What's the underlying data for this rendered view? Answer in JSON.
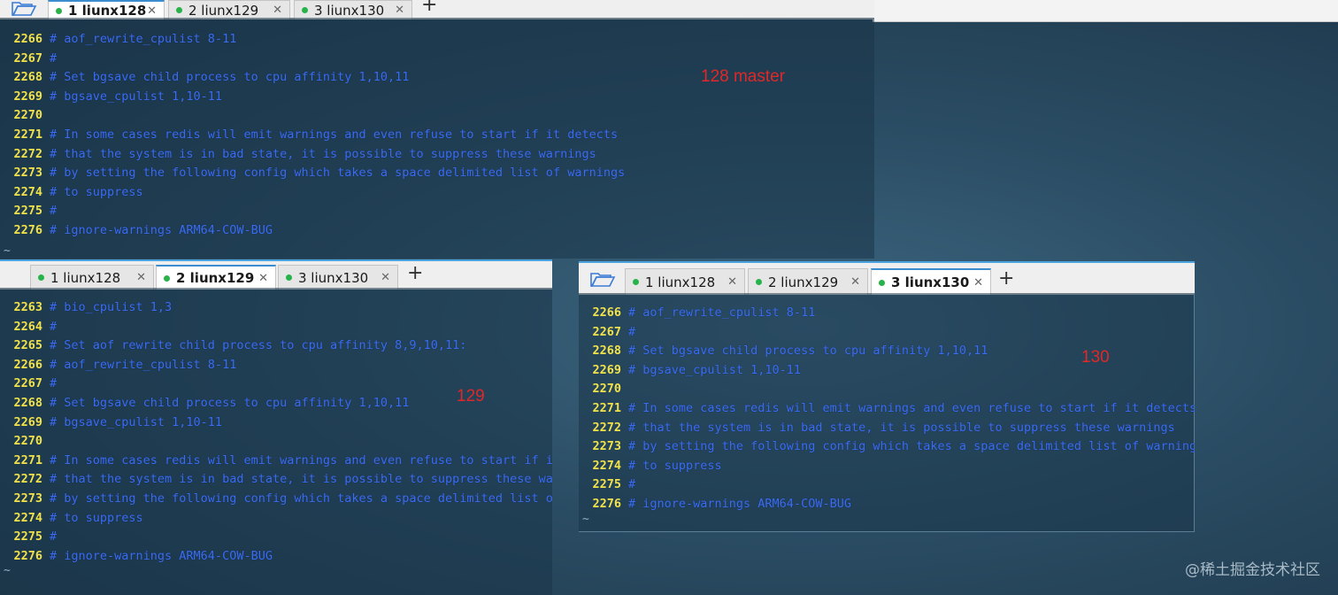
{
  "tab_labels": [
    "1 liunx128",
    "2 liunx129",
    "3 liunx130"
  ],
  "new_tab_label": "+",
  "close_glyph": "✕",
  "tilde": "~",
  "window_128": {
    "active_tab": 0,
    "note": "128 master",
    "lines": [
      {
        "n": "2266",
        "t": "# aof_rewrite_cpulist 8-11"
      },
      {
        "n": "2267",
        "t": "#"
      },
      {
        "n": "2268",
        "t": "# Set bgsave child process to cpu affinity 1,10,11"
      },
      {
        "n": "2269",
        "t": "# bgsave_cpulist 1,10-11"
      },
      {
        "n": "2270",
        "t": ""
      },
      {
        "n": "2271",
        "t": "# In some cases redis will emit warnings and even refuse to start if it detects"
      },
      {
        "n": "2272",
        "t": "# that the system is in bad state, it is possible to suppress these warnings"
      },
      {
        "n": "2273",
        "t": "# by setting the following config which takes a space delimited list of warnings"
      },
      {
        "n": "2274",
        "t": "# to suppress"
      },
      {
        "n": "2275",
        "t": "#"
      },
      {
        "n": "2276",
        "t": "# ignore-warnings ARM64-COW-BUG"
      }
    ]
  },
  "window_129": {
    "active_tab": 1,
    "note": "129",
    "lines": [
      {
        "n": "2263",
        "t": "# bio_cpulist 1,3"
      },
      {
        "n": "2264",
        "t": "#"
      },
      {
        "n": "2265",
        "t": "# Set aof rewrite child process to cpu affinity 8,9,10,11:"
      },
      {
        "n": "2266",
        "t": "# aof_rewrite_cpulist 8-11"
      },
      {
        "n": "2267",
        "t": "#"
      },
      {
        "n": "2268",
        "t": "# Set bgsave child process to cpu affinity 1,10,11"
      },
      {
        "n": "2269",
        "t": "# bgsave_cpulist 1,10-11"
      },
      {
        "n": "2270",
        "t": ""
      },
      {
        "n": "2271",
        "t": "# In some cases redis will emit warnings and even refuse to start if it d"
      },
      {
        "n": "2272",
        "t": "# that the system is in bad state, it is possible to suppress these warni"
      },
      {
        "n": "2273",
        "t": "# by setting the following config which takes a space delimited list of w"
      },
      {
        "n": "2274",
        "t": "# to suppress"
      },
      {
        "n": "2275",
        "t": "#"
      },
      {
        "n": "2276",
        "t": "# ignore-warnings ARM64-COW-BUG"
      }
    ]
  },
  "window_130": {
    "active_tab": 2,
    "note": "130",
    "lines": [
      {
        "n": "2266",
        "t": "# aof_rewrite_cpulist 8-11"
      },
      {
        "n": "2267",
        "t": "#"
      },
      {
        "n": "2268",
        "t": "# Set bgsave child process to cpu affinity 1,10,11"
      },
      {
        "n": "2269",
        "t": "# bgsave_cpulist 1,10-11"
      },
      {
        "n": "2270",
        "t": ""
      },
      {
        "n": "2271",
        "t": "# In some cases redis will emit warnings and even refuse to start if it detects"
      },
      {
        "n": "2272",
        "t": "# that the system is in bad state, it is possible to suppress these warnings"
      },
      {
        "n": "2273",
        "t": "# by setting the following config which takes a space delimited list of warnings"
      },
      {
        "n": "2274",
        "t": "# to suppress"
      },
      {
        "n": "2275",
        "t": "#"
      },
      {
        "n": "2276",
        "t": "# ignore-warnings ARM64-COW-BUG"
      }
    ]
  },
  "watermark": "@稀土掘金技术社区",
  "colors": {
    "line_number": "#f2e24a",
    "comment_text": "#3a6cf0",
    "cursor": "#27b24a",
    "tab_dot": "#27b24a",
    "note": "#e02828",
    "active_tab_border": "#3c8dd0"
  }
}
